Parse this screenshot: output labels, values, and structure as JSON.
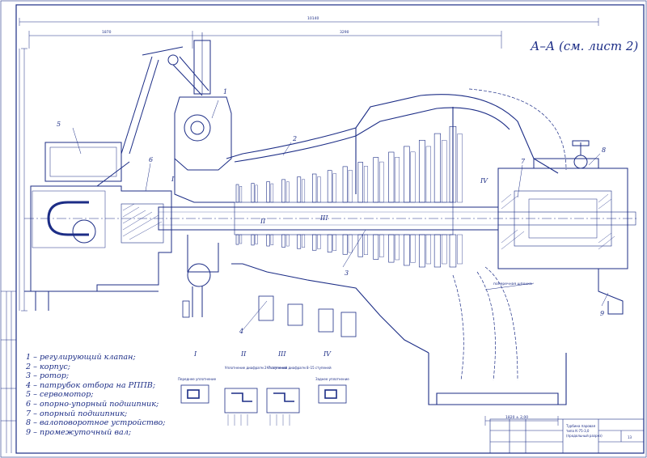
{
  "section_title": "А–А (см. лист 2)",
  "callout_numbers": [
    "1",
    "2",
    "3",
    "4",
    "5",
    "6",
    "7",
    "8",
    "9"
  ],
  "zone_labels": [
    "I",
    "II",
    "III",
    "IV"
  ],
  "legend": [
    "1 – регулирующий клапан;",
    "2 – корпус;",
    "3 – ротор;",
    "4 – патрубок отбора на РППВ;",
    "5 – сервомотор;",
    "6 – опорно-упорный подшипник;",
    "7 – опорный подшипник;",
    "8 – валоповоротное устройство;",
    "9 – промежуточный вал;"
  ],
  "detail_captions": {
    "I": "Переднее уплотнение",
    "II": "Уплотнение диафрагм 2–7 ступеней",
    "III": "Уплотнение диафрагм 8–15 ступеней",
    "IV": "Заднее уплотнение"
  },
  "annotation_shponka": "поперечная шпонка",
  "dimensions": {
    "overall": "10140",
    "left": "1870",
    "mid": "3290",
    "base": "1820 ± 2,00"
  },
  "title_block": {
    "title_line1": "Турбина паровая",
    "title_line2": "типа К-75-3,0",
    "title_line3": "(продольный разрез)",
    "sheet_no": "13"
  }
}
